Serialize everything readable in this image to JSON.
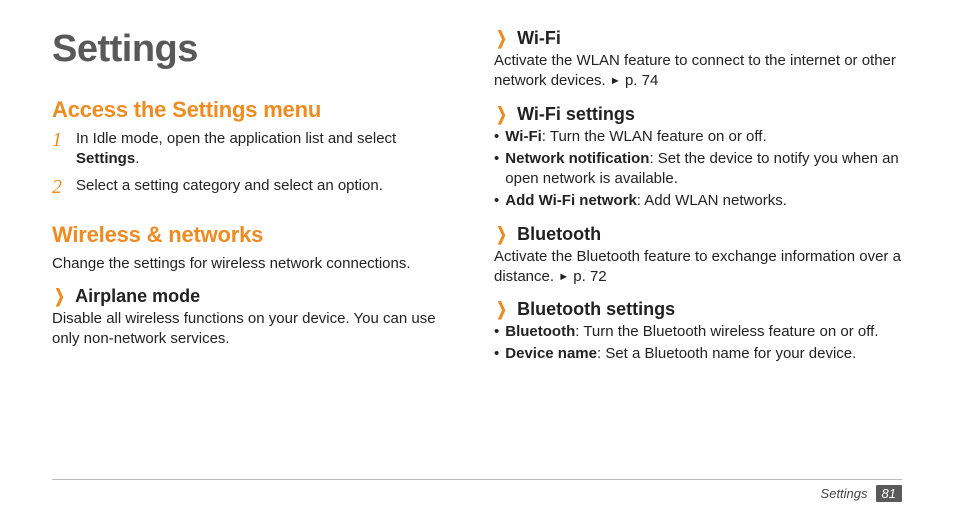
{
  "page_title": "Settings",
  "left": {
    "h2a": "Access the Settings menu",
    "steps": [
      {
        "num": "1",
        "pre": "In Idle mode, open the application list and select ",
        "bold": "Settings",
        "post": "."
      },
      {
        "num": "2",
        "pre": "Select a setting category and select an option.",
        "bold": "",
        "post": ""
      }
    ],
    "h2b": "Wireless & networks",
    "h2b_body": "Change the settings for wireless network connections.",
    "airplane": {
      "title": "Airplane mode",
      "body": "Disable all wireless functions on your device. You can use only non-network services."
    }
  },
  "right": {
    "wifi": {
      "title": "Wi-Fi",
      "body_pre": "Activate the WLAN feature to connect to the internet or other network devices. ",
      "ref": "p. 74"
    },
    "wifi_settings": {
      "title": "Wi-Fi settings",
      "items": [
        {
          "bold": "Wi-Fi",
          "rest": ": Turn the WLAN feature on or off."
        },
        {
          "bold": "Network notification",
          "rest": ": Set the device to notify you when an open network is available."
        },
        {
          "bold": "Add Wi-Fi network",
          "rest": ": Add WLAN networks."
        }
      ]
    },
    "bluetooth": {
      "title": "Bluetooth",
      "body_pre": "Activate the Bluetooth feature to exchange information over a distance. ",
      "ref": "p. 72"
    },
    "bluetooth_settings": {
      "title": "Bluetooth settings",
      "items": [
        {
          "bold": "Bluetooth",
          "rest": ": Turn the Bluetooth wireless feature on or off."
        },
        {
          "bold": "Device name",
          "rest": ": Set a Bluetooth name for your device."
        }
      ]
    }
  },
  "footer": {
    "label": "Settings",
    "page": "81"
  },
  "tri_glyph": "►"
}
